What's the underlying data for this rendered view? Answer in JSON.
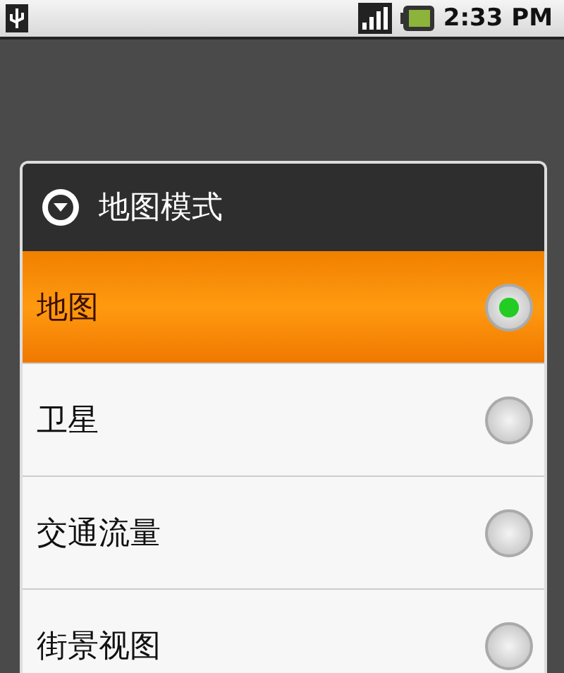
{
  "status_bar": {
    "time": "2:33 PM"
  },
  "dialog": {
    "title": "地图模式",
    "options": [
      {
        "label": "地图",
        "selected": true
      },
      {
        "label": "卫星",
        "selected": false
      },
      {
        "label": "交通流量",
        "selected": false
      },
      {
        "label": "街景视图",
        "selected": false
      }
    ]
  }
}
